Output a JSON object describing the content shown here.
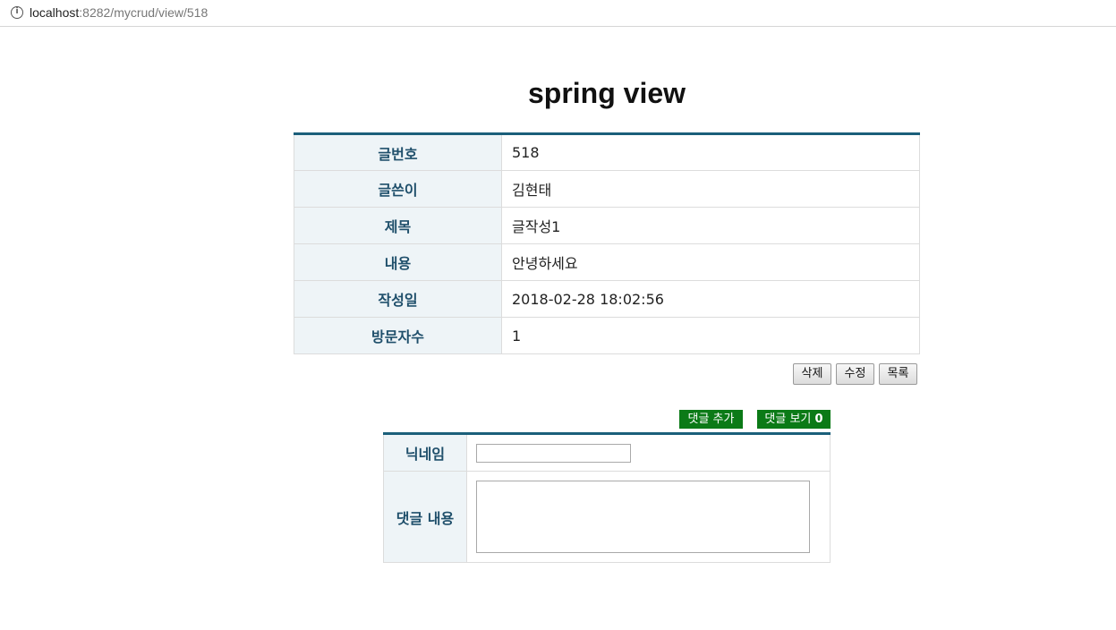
{
  "browser": {
    "url_host": "localhost",
    "url_path": ":8282/mycrud/view/518"
  },
  "page": {
    "title": "spring view"
  },
  "post": {
    "rows": [
      {
        "label": "글번호",
        "value": "518"
      },
      {
        "label": "글쓴이",
        "value": "김현태"
      },
      {
        "label": "제목",
        "value": "글작성1"
      },
      {
        "label": "내용",
        "value": "안녕하세요"
      },
      {
        "label": "작성일",
        "value": "2018-02-28 18:02:56"
      },
      {
        "label": "방문자수",
        "value": "1"
      }
    ]
  },
  "actions": {
    "delete_label": "삭제",
    "edit_label": "수정",
    "list_label": "목록"
  },
  "comments": {
    "add_label": "댓글 추가",
    "view_label": "댓글 보기",
    "count": "0",
    "nickname_label": "닉네임",
    "nickname_value": "",
    "content_label": "댓글 내용",
    "content_value": ""
  },
  "colors": {
    "accent": "#1b5f7a",
    "header_bg": "#eef4f7",
    "green_button": "#0b7a17"
  },
  "icons": {
    "site_info": "info-circle-icon"
  }
}
